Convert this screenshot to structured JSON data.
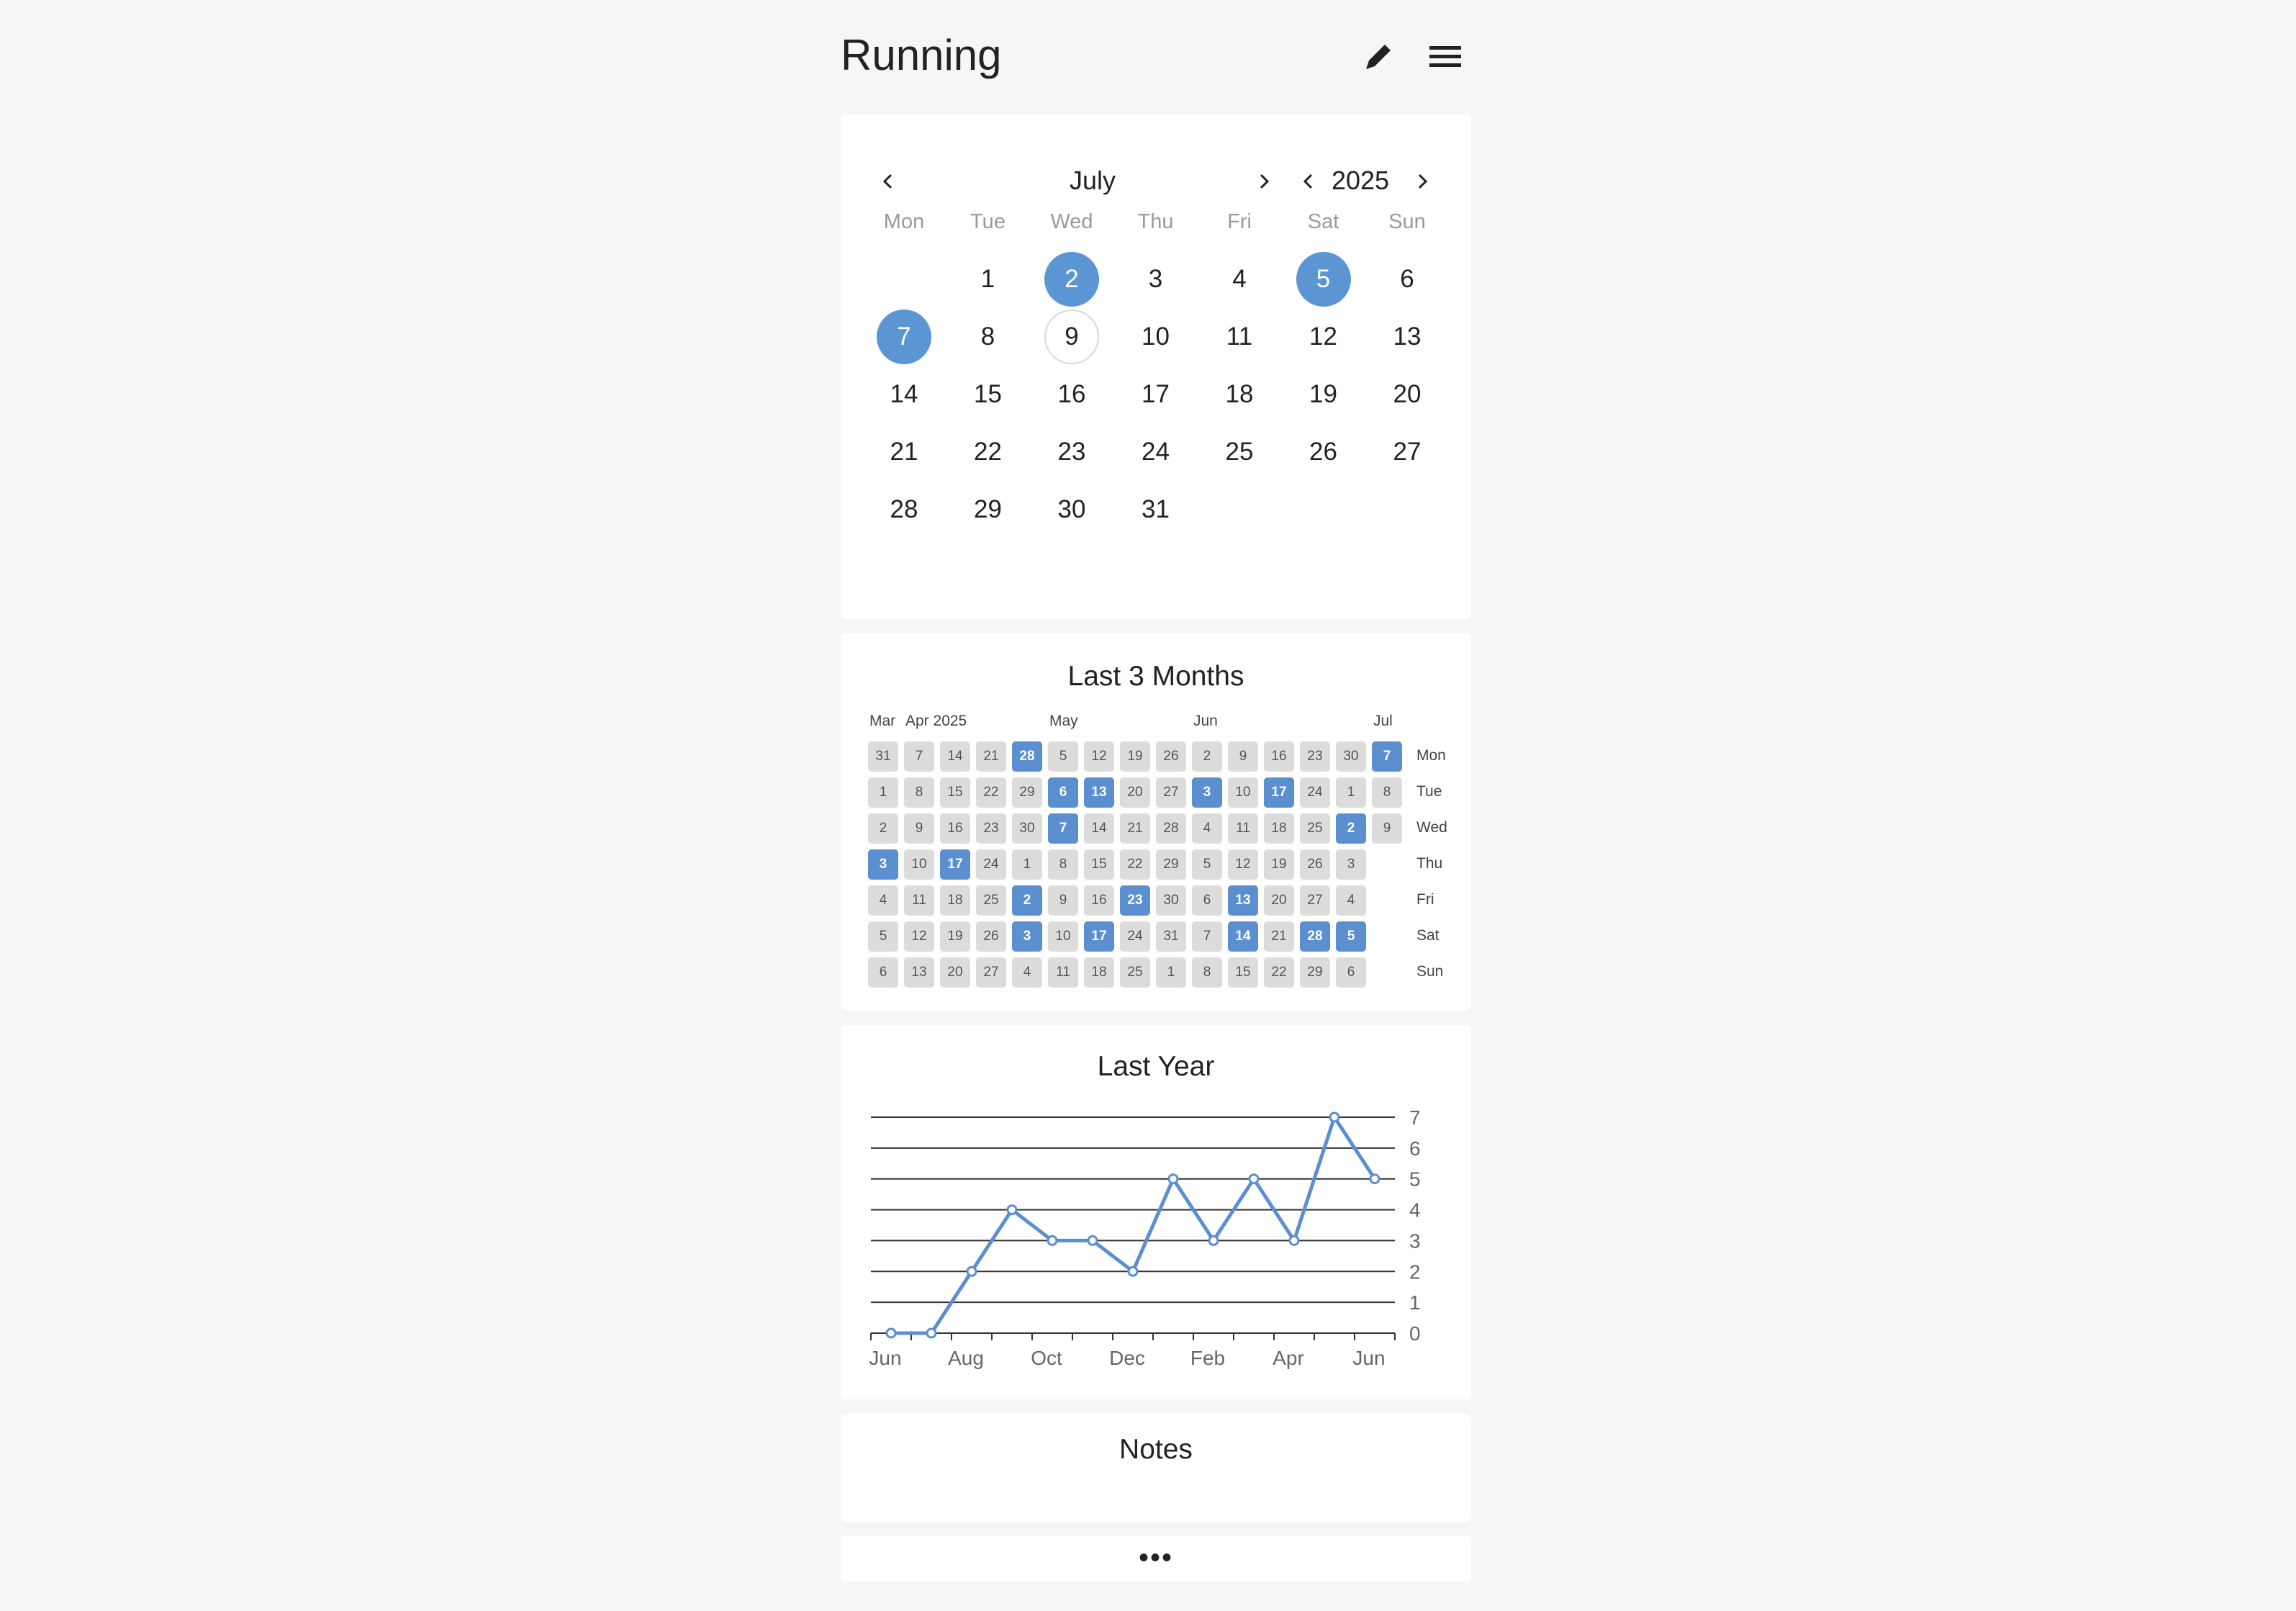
{
  "header": {
    "title": "Running",
    "edit_icon": "pencil-icon",
    "menu_icon": "hamburger-menu-icon"
  },
  "calendar": {
    "month": "July",
    "year": "2025",
    "weekdays": [
      "Mon",
      "Tue",
      "Wed",
      "Thu",
      "Fri",
      "Sat",
      "Sun"
    ],
    "first_weekday_index": 1,
    "days_in_month": 31,
    "selected_days": [
      2,
      5,
      7
    ],
    "today": 9
  },
  "last3": {
    "title": "Last 3 Months",
    "month_labels": [
      {
        "text": "Mar",
        "col": 0
      },
      {
        "text": "Apr 2025",
        "col": 1
      },
      {
        "text": "May",
        "col": 5
      },
      {
        "text": "Jun",
        "col": 9
      },
      {
        "text": "Jul",
        "col": 14
      }
    ],
    "weekday_labels": [
      "Mon",
      "Tue",
      "Wed",
      "Thu",
      "Fri",
      "Sat",
      "Sun"
    ],
    "columns": [
      [
        "31",
        "1",
        "2",
        "3",
        "4",
        "5",
        "6"
      ],
      [
        "7",
        "8",
        "9",
        "10",
        "11",
        "12",
        "13"
      ],
      [
        "14",
        "15",
        "16",
        "17",
        "18",
        "19",
        "20"
      ],
      [
        "21",
        "22",
        "23",
        "24",
        "25",
        "26",
        "27"
      ],
      [
        "28",
        "29",
        "30",
        "1",
        "2",
        "3",
        "4"
      ],
      [
        "5",
        "6",
        "7",
        "8",
        "9",
        "10",
        "11"
      ],
      [
        "12",
        "13",
        "14",
        "15",
        "16",
        "17",
        "18"
      ],
      [
        "19",
        "20",
        "21",
        "22",
        "23",
        "24",
        "25"
      ],
      [
        "26",
        "27",
        "28",
        "29",
        "30",
        "31",
        "1"
      ],
      [
        "2",
        "3",
        "4",
        "5",
        "6",
        "7",
        "8"
      ],
      [
        "9",
        "10",
        "11",
        "12",
        "13",
        "14",
        "15"
      ],
      [
        "16",
        "17",
        "18",
        "19",
        "20",
        "21",
        "22"
      ],
      [
        "23",
        "24",
        "25",
        "26",
        "27",
        "28",
        "29"
      ],
      [
        "30",
        "1",
        "2",
        "3",
        "4",
        "5",
        "6"
      ],
      [
        "7",
        "8",
        "9",
        "",
        "",
        "",
        ""
      ]
    ],
    "active": [
      [
        0,
        3
      ],
      [
        2,
        3
      ],
      [
        4,
        0
      ],
      [
        4,
        4
      ],
      [
        4,
        5
      ],
      [
        5,
        1
      ],
      [
        5,
        2
      ],
      [
        6,
        1
      ],
      [
        6,
        5
      ],
      [
        7,
        4
      ],
      [
        9,
        1
      ],
      [
        10,
        4
      ],
      [
        10,
        5
      ],
      [
        11,
        1
      ],
      [
        12,
        5
      ],
      [
        13,
        2
      ],
      [
        13,
        5
      ],
      [
        14,
        0
      ]
    ]
  },
  "chart_data": {
    "type": "line",
    "title": "Last Year",
    "x": [
      "Jun",
      "Jul",
      "Aug",
      "Sep",
      "Oct",
      "Nov",
      "Dec",
      "Jan",
      "Feb",
      "Mar",
      "Apr",
      "May",
      "Jun",
      "Jul"
    ],
    "x_tick_labels": [
      "Jun",
      "Aug",
      "Oct",
      "Dec",
      "Feb",
      "Apr",
      "Jun"
    ],
    "series": [
      {
        "values": [
          0,
          0,
          2,
          4,
          3,
          3,
          2,
          5,
          3,
          5,
          3,
          7,
          5
        ]
      }
    ],
    "ylim": [
      0,
      7
    ],
    "yticks": [
      "0",
      "1",
      "2",
      "3",
      "4",
      "5",
      "6",
      "7"
    ],
    "grid": true,
    "color": "#5b8fd0"
  },
  "notes": {
    "title": "Notes"
  },
  "footer": {
    "more_label": "•••"
  }
}
